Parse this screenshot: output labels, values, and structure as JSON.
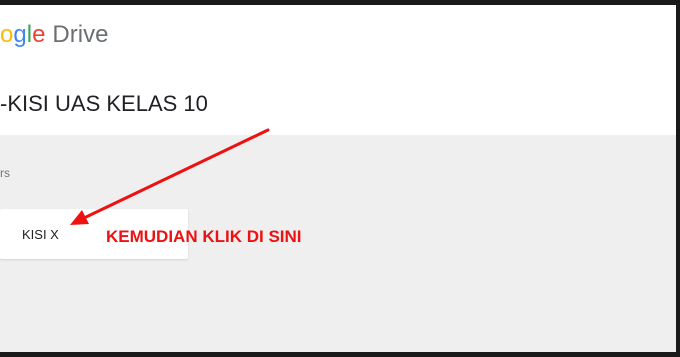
{
  "app": {
    "logo_partial": "ogle",
    "product": "Drive"
  },
  "folder": {
    "title": "-KISI UAS KELAS 10"
  },
  "section": {
    "label": "rs"
  },
  "items": [
    {
      "name": "KISI X"
    }
  ],
  "annotation": {
    "text": "KEMUDIAN KLIK DI SINI",
    "color": "#ee1111"
  },
  "colors": {
    "background": "#efefef",
    "header_bg": "#ffffff"
  }
}
